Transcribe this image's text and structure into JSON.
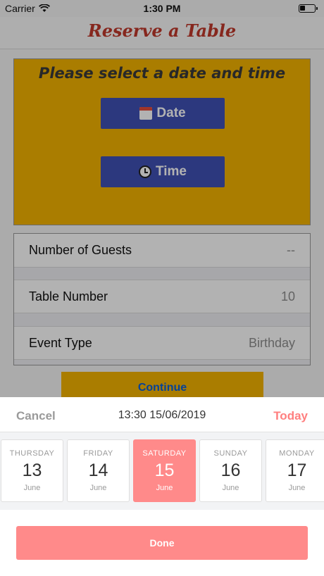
{
  "status_bar": {
    "carrier": "Carrier",
    "time": "1:30 PM"
  },
  "nav": {
    "title": "Reserve a Table"
  },
  "select_panel": {
    "heading": "Please select a date and time",
    "date_label": "Date",
    "time_label": "Time"
  },
  "details": [
    {
      "label": "Number of Guests",
      "value": "--"
    },
    {
      "label": "Table Number",
      "value": "10"
    },
    {
      "label": "Event Type",
      "value": "Birthday"
    }
  ],
  "continue_label": "Continue",
  "picker": {
    "cancel_label": "Cancel",
    "selected_text": "13:30 15/06/2019",
    "today_label": "Today",
    "days": [
      {
        "weekday": "THURSDAY",
        "day": "13",
        "month": "June"
      },
      {
        "weekday": "FRIDAY",
        "day": "14",
        "month": "June"
      },
      {
        "weekday": "SATURDAY",
        "day": "15",
        "month": "June"
      },
      {
        "weekday": "SUNDAY",
        "day": "16",
        "month": "June"
      },
      {
        "weekday": "MONDAY",
        "day": "17",
        "month": "June"
      }
    ],
    "selected_index": 2,
    "done_label": "Done"
  },
  "colors": {
    "title_red": "#c0392b",
    "panel_yellow": "#f4b400",
    "button_indigo": "#3f51b5",
    "accent_pink": "#ff8a8a",
    "link_blue": "#0a5fd9"
  },
  "icons": [
    "wifi-icon",
    "battery-icon",
    "calendar-icon",
    "clock-icon"
  ]
}
